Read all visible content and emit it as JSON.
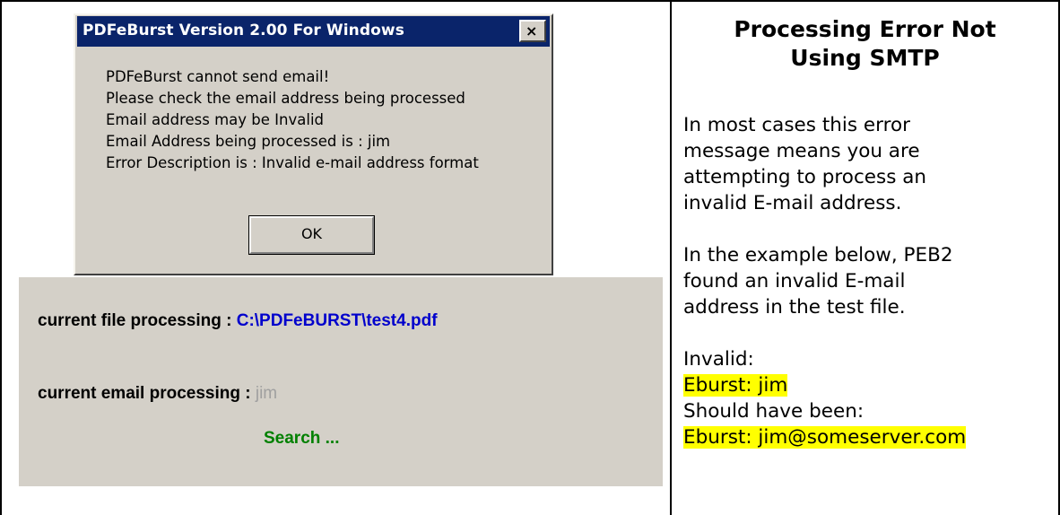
{
  "dialog": {
    "title": "PDFeBurst Version 2.00 For Windows",
    "close_label": "×",
    "messages": [
      "PDFeBurst cannot send email!",
      "Please check the email address being processed",
      "Email address may be Invalid",
      "Email Address being processed is : jim",
      "Error Description is : Invalid e-mail address format"
    ],
    "ok_label": "OK"
  },
  "status": {
    "file_label": "current file processing : ",
    "file_value": "C:\\PDFeBURST\\test4.pdf",
    "email_label": "current email processing : ",
    "email_value": "jim",
    "search_text": "Search ..."
  },
  "article": {
    "heading_line1": "Processing Error Not",
    "heading_line2": "Using SMTP",
    "para1_lines": [
      "In most cases this error",
      "message means you are",
      "attempting to process an",
      "invalid E-mail address."
    ],
    "para2_lines": [
      "In the example below, PEB2",
      "found an invalid E-mail",
      "address in the test file."
    ],
    "invalid_label": "Invalid:",
    "invalid_value": "Eburst: jim",
    "should_label": "Should have been:",
    "should_value": "Eburst: jim@someserver.com"
  },
  "colors": {
    "titlebar": "#0a246a",
    "dialog_bg": "#d4d0c8",
    "path_blue": "#0000cc",
    "search_green": "#008000",
    "highlight": "#ffff00"
  },
  "icons": {
    "close": "close-icon"
  }
}
